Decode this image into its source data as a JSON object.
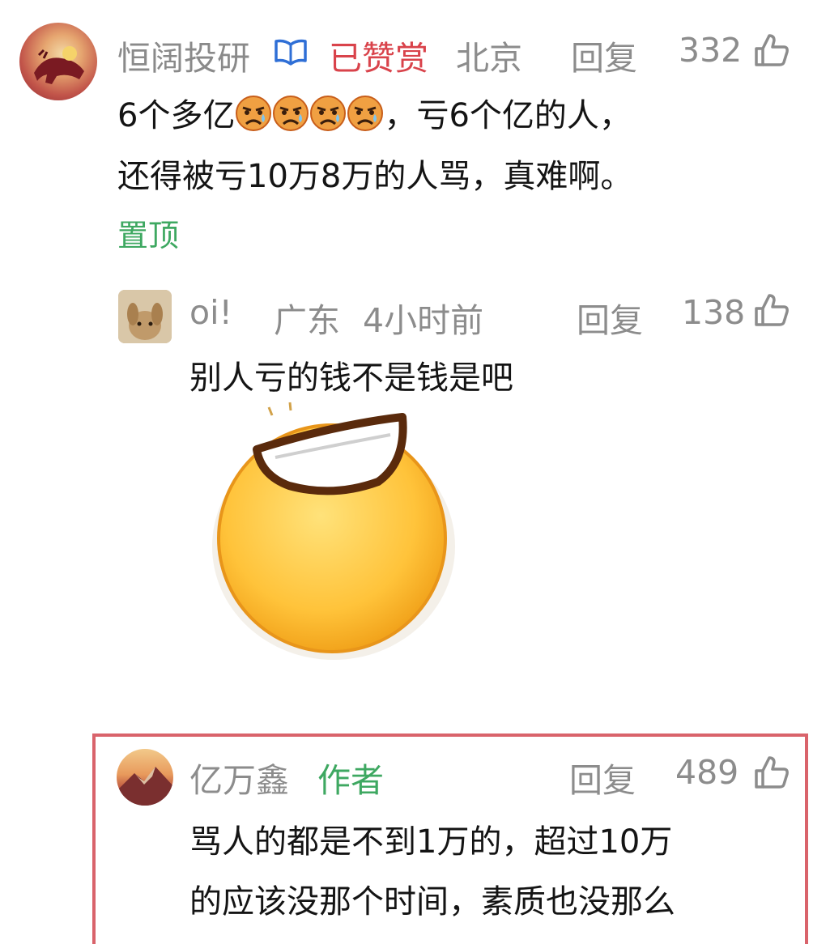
{
  "comment1": {
    "username": "恒阔投研",
    "badge_icon": "book-badge-icon",
    "reward_tag": "已赞赏",
    "location": "北京",
    "reply_label": "回复",
    "like_count": "332",
    "text_line1_before": "6个多亿",
    "text_line1_after": "，亏6个亿的人，",
    "text_line2": "还得被亏10万8万的人骂，真难啊。",
    "pinned_label": "置顶"
  },
  "reply1": {
    "username": "oi!",
    "location": "广东",
    "time": "4小时前",
    "reply_label": "回复",
    "like_count": "138",
    "text": "别人亏的钱不是钱是吧"
  },
  "reply2": {
    "username": "亿万鑫",
    "author_tag": "作者",
    "reply_label": "回复",
    "like_count": "489",
    "text_line1": "骂人的都是不到1万的，超过10万",
    "text_line2": "的应该没那个时间，素质也没那么"
  },
  "colors": {
    "username_gray": "#8c8c8c",
    "reward_red": "#d9434b",
    "green": "#3ea861",
    "highlight_border": "#d9636b"
  }
}
